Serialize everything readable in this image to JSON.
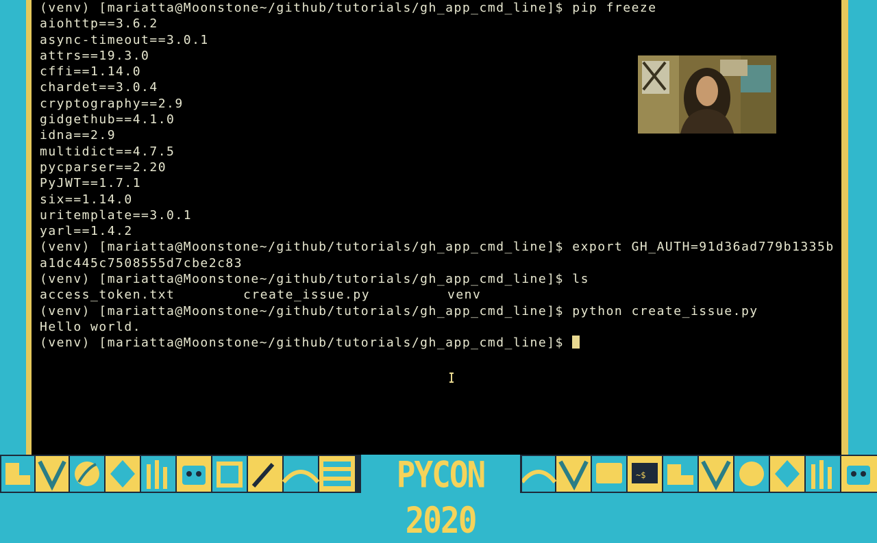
{
  "terminal": {
    "lines": [
      "(venv) [mariatta@Moonstone~/github/tutorials/gh_app_cmd_line]$ pip freeze",
      "aiohttp==3.6.2",
      "async-timeout==3.0.1",
      "attrs==19.3.0",
      "cffi==1.14.0",
      "chardet==3.0.4",
      "cryptography==2.9",
      "gidgethub==4.1.0",
      "idna==2.9",
      "multidict==4.7.5",
      "pycparser==2.20",
      "PyJWT==1.7.1",
      "six==1.14.0",
      "uritemplate==3.0.1",
      "yarl==1.4.2",
      "(venv) [mariatta@Moonstone~/github/tutorials/gh_app_cmd_line]$ export GH_AUTH=91d36ad779b1335b",
      "a1dc445c7508555d7cbe2c83",
      "(venv) [mariatta@Moonstone~/github/tutorials/gh_app_cmd_line]$ ls"
    ],
    "ls_output": [
      "access_token.txt",
      "create_issue.py",
      "venv"
    ],
    "after_ls": [
      "(venv) [mariatta@Moonstone~/github/tutorials/gh_app_cmd_line]$ python create_issue.py",
      "Hello world."
    ],
    "current_prompt": "(venv) [mariatta@Moonstone~/github/tutorials/gh_app_cmd_line]$ "
  },
  "banner": {
    "logo_text": "PYCON 2020"
  },
  "colors": {
    "terminal_bg": "#000000",
    "terminal_fg": "#e8e8d0",
    "frame": "#31b8cc",
    "accent": "#f5d35a"
  }
}
